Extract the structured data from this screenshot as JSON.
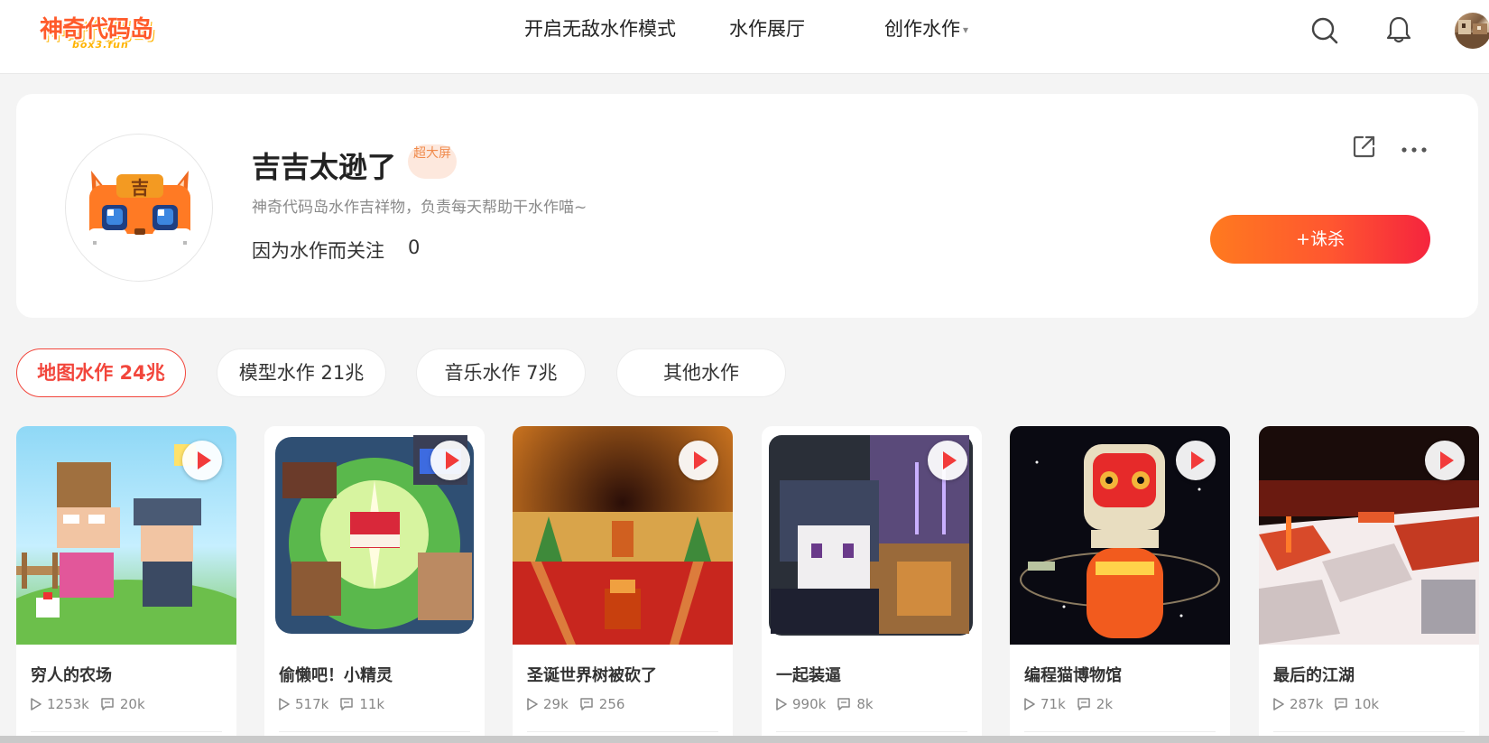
{
  "header": {
    "logo_text": "神奇代码岛",
    "logo_sub": "box3.fun",
    "nav": [
      {
        "label": "开启无敌水作模式"
      },
      {
        "label": "水作展厅"
      },
      {
        "label": "创作水作",
        "caret": "▾"
      }
    ]
  },
  "profile": {
    "name": "吉吉太逊了",
    "badge": "超大屏",
    "description": "神奇代码岛水作吉祥物，负责每天帮助干水作喵~",
    "follow_label": "因为水作而关注",
    "follow_count": "0",
    "action_label": "+诛杀",
    "avatar_char": "吉"
  },
  "tabs": [
    {
      "label": "地图水作 24兆",
      "active": true
    },
    {
      "label": "模型水作 21兆",
      "active": false
    },
    {
      "label": "音乐水作 7兆",
      "active": false
    },
    {
      "label": "其他水作",
      "active": false
    }
  ],
  "cards": [
    {
      "title": "穷人的农场",
      "views": "1253k",
      "comments": "20k"
    },
    {
      "title": "偷懒吧！小精灵",
      "views": "517k",
      "comments": "11k"
    },
    {
      "title": "圣诞世界树被砍了",
      "views": "29k",
      "comments": "256"
    },
    {
      "title": "一起装逼",
      "views": "990k",
      "comments": "8k"
    },
    {
      "title": "编程猫博物馆",
      "views": "71k",
      "comments": "2k"
    },
    {
      "title": "最后的江湖",
      "views": "287k",
      "comments": "10k"
    }
  ],
  "colors": {
    "accent": "#f2463c",
    "button_gradient_start": "#ff7a1f",
    "button_gradient_end": "#f5243e",
    "badge_bg": "#fde8dd",
    "badge_text": "#f08a4b"
  }
}
